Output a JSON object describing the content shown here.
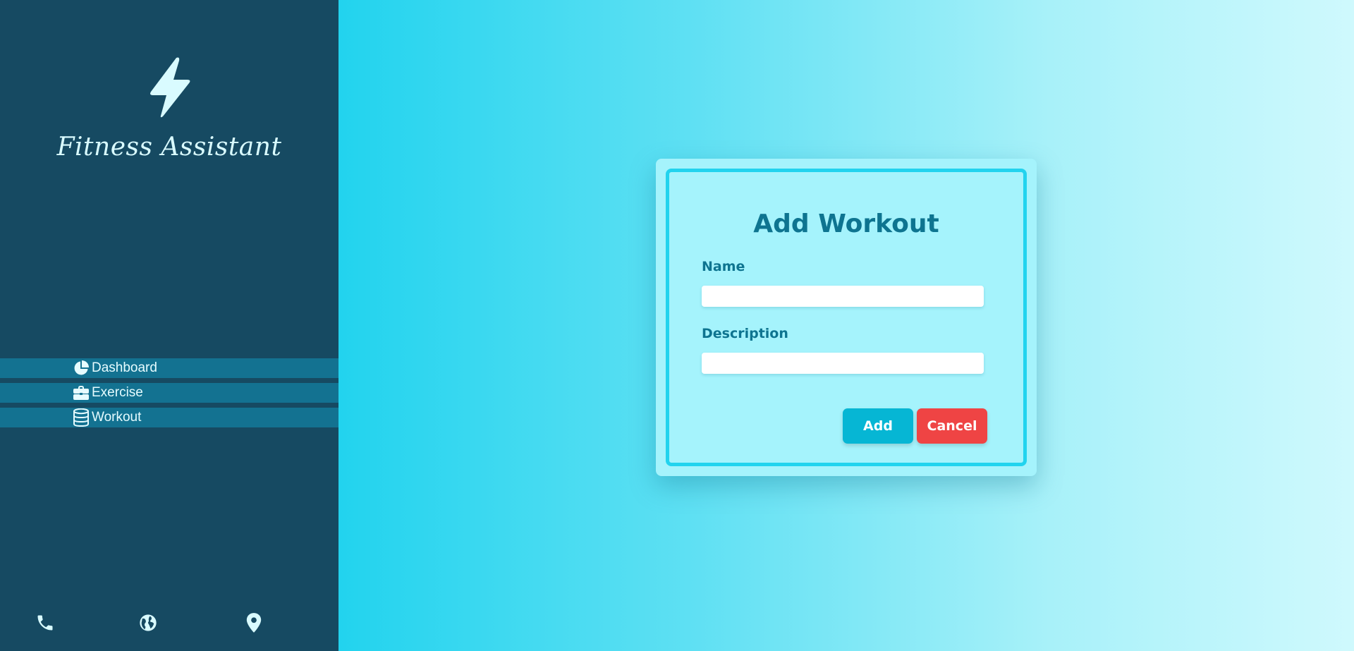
{
  "app": {
    "title": "Fitness Assistant",
    "logo_icon": "bolt-icon"
  },
  "sidebar": {
    "items": [
      {
        "label": "Dashboard",
        "icon": "pie-chart-icon"
      },
      {
        "label": "Exercise",
        "icon": "briefcase-icon"
      },
      {
        "label": "Workout",
        "icon": "database-icon"
      }
    ],
    "footer_icons": [
      "phone-icon",
      "globe-icon",
      "location-pin-icon"
    ]
  },
  "modal": {
    "title": "Add Workout",
    "fields": [
      {
        "label": "Name",
        "value": "",
        "placeholder": ""
      },
      {
        "label": "Description",
        "value": "",
        "placeholder": ""
      }
    ],
    "add_label": "Add",
    "cancel_label": "Cancel"
  },
  "colors": {
    "sidebar_bg": "#164a62",
    "nav_item_bg": "#137291",
    "accent": "#06b6d4",
    "title_text": "#0e7490",
    "danger": "#ef4444",
    "modal_bg": "#a5f3fc",
    "modal_border": "#22d3ee"
  }
}
